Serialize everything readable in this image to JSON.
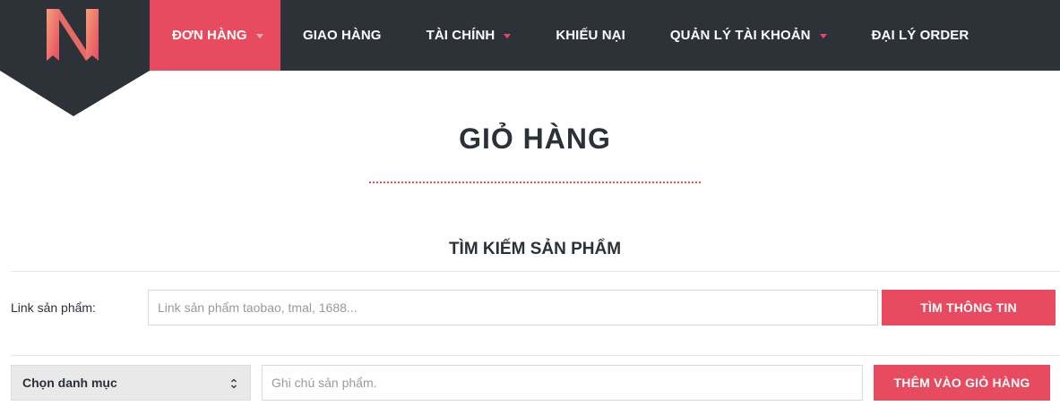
{
  "colors": {
    "navbar": "#2c3238",
    "accent": "#e84a5f",
    "text": "#2b3138"
  },
  "logo": {
    "icon": "n-logo-icon"
  },
  "nav": {
    "items": [
      {
        "label": "ĐƠN HÀNG",
        "active": true,
        "dropdown": true
      },
      {
        "label": "GIAO HÀNG",
        "active": false,
        "dropdown": false
      },
      {
        "label": "TÀI CHÍNH",
        "active": false,
        "dropdown": true
      },
      {
        "label": "KHIẾU NẠI",
        "active": false,
        "dropdown": false
      },
      {
        "label": "QUẢN LÝ TÀI KHOẢN",
        "active": false,
        "dropdown": true
      },
      {
        "label": "ĐẠI LÝ ORDER",
        "active": false,
        "dropdown": false
      }
    ]
  },
  "page": {
    "title": "GIỎ HÀNG"
  },
  "search": {
    "section_title": "TÌM KIẾM SẢN PHẨM",
    "link_label": "Link sản phẩm:",
    "link_placeholder": "Link sản phẩm taobao, tmal, 1688...",
    "find_button": "TÌM THÔNG TIN"
  },
  "add": {
    "category_selected": "Chọn danh mục",
    "note_placeholder": "Ghi chú sản phẩm.",
    "add_button": "THÊM VÀO GIỎ HÀNG"
  }
}
